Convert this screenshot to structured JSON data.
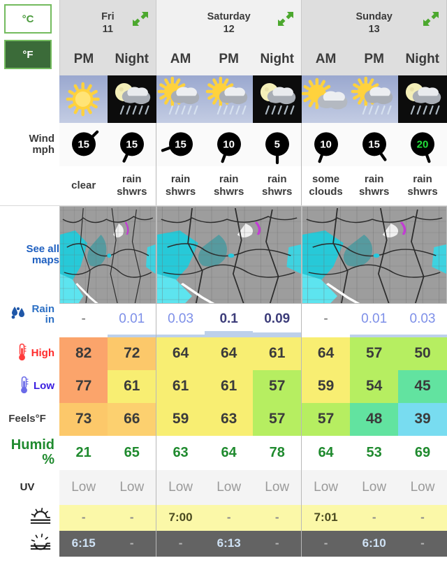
{
  "units": {
    "celsius_label": "°C",
    "fahrenheit_label": "°F",
    "selected": "°F"
  },
  "row_labels": {
    "wind": "Wind",
    "wind_unit": "mph",
    "see_all_maps_line1": "See all",
    "see_all_maps_line2": "maps",
    "rain": "Rain",
    "rain_unit": "in",
    "high": "High",
    "low": "Low",
    "feels": "Feels°F",
    "humid": "Humid",
    "humid_unit": "%",
    "uv": "UV"
  },
  "days": [
    {
      "name": "Fri",
      "date": "11",
      "slots": [
        "PM",
        "Night"
      ]
    },
    {
      "name": "Saturday",
      "date": "12",
      "slots": [
        "AM",
        "PM",
        "Night"
      ]
    },
    {
      "name": "Sunday",
      "date": "13",
      "slots": [
        "AM",
        "PM",
        "Night"
      ]
    }
  ],
  "columns": [
    {
      "day": "Fri",
      "slot": "PM",
      "night": false,
      "icon": "sun-clear-icon",
      "wind_speed": "15",
      "wind_dir_deg": 45,
      "wind_strong": false,
      "condition_line1": "clear",
      "condition_line2": "",
      "rain": "-",
      "rain_bar_pct": 0,
      "rain_emphasis": false,
      "high": "82",
      "high_color": "#fba46b",
      "low": "77",
      "low_color": "#fba46b",
      "feels": "73",
      "feels_color": "#fcc86a",
      "humid": "21",
      "uv": "Low",
      "sunrise": "-",
      "sunset": "6:15"
    },
    {
      "day": "Fri",
      "slot": "Night",
      "night": true,
      "icon": "moon-rain-icon",
      "wind_speed": "15",
      "wind_dir_deg": 205,
      "wind_strong": false,
      "condition_line1": "rain",
      "condition_line2": "shwrs",
      "rain": "0.01",
      "rain_bar_pct": 8,
      "rain_emphasis": false,
      "high": "72",
      "high_color": "#fcc86a",
      "low": "61",
      "low_color": "#f8ee72",
      "feels": "66",
      "feels_color": "#fcd06f",
      "humid": "65",
      "uv": "Low",
      "sunrise": "-",
      "sunset": "-"
    },
    {
      "day": "Saturday",
      "slot": "AM",
      "night": false,
      "icon": "sun-rain-icon",
      "wind_speed": "15",
      "wind_dir_deg": 250,
      "wind_strong": false,
      "condition_line1": "rain",
      "condition_line2": "shwrs",
      "rain": "0.03",
      "rain_bar_pct": 10,
      "rain_emphasis": false,
      "high": "64",
      "high_color": "#f8ee72",
      "low": "61",
      "low_color": "#f8ee72",
      "feels": "59",
      "feels_color": "#f8ee72",
      "humid": "63",
      "uv": "Low",
      "sunrise": "7:00",
      "sunset": "-"
    },
    {
      "day": "Saturday",
      "slot": "PM",
      "night": false,
      "icon": "sun-rain-icon",
      "wind_speed": "10",
      "wind_dir_deg": 200,
      "wind_strong": false,
      "condition_line1": "rain",
      "condition_line2": "shwrs",
      "rain": "0.1",
      "rain_bar_pct": 30,
      "rain_emphasis": true,
      "high": "64",
      "high_color": "#f8ee72",
      "low": "61",
      "low_color": "#f8ee72",
      "feels": "63",
      "feels_color": "#f8ee72",
      "humid": "64",
      "uv": "Low",
      "sunrise": "-",
      "sunset": "6:13"
    },
    {
      "day": "Saturday",
      "slot": "Night",
      "night": true,
      "icon": "moon-rain-icon",
      "wind_speed": "5",
      "wind_dir_deg": 180,
      "wind_strong": false,
      "condition_line1": "rain",
      "condition_line2": "shwrs",
      "rain": "0.09",
      "rain_bar_pct": 22,
      "rain_emphasis": true,
      "high": "61",
      "high_color": "#f8ee72",
      "low": "57",
      "low_color": "#b6ee61",
      "feels": "57",
      "feels_color": "#b6ee61",
      "humid": "78",
      "uv": "Low",
      "sunrise": "-",
      "sunset": "-"
    },
    {
      "day": "Sunday",
      "slot": "AM",
      "night": false,
      "icon": "sun-cloud-icon",
      "wind_speed": "10",
      "wind_dir_deg": 200,
      "wind_strong": false,
      "condition_line1": "some",
      "condition_line2": "clouds",
      "rain": "-",
      "rain_bar_pct": 0,
      "rain_emphasis": false,
      "high": "64",
      "high_color": "#f8ee72",
      "low": "59",
      "low_color": "#f8ee72",
      "feels": "57",
      "feels_color": "#b6ee61",
      "humid": "64",
      "uv": "Low",
      "sunrise": "7:01",
      "sunset": "-"
    },
    {
      "day": "Sunday",
      "slot": "PM",
      "night": false,
      "icon": "sun-rain-icon",
      "wind_speed": "15",
      "wind_dir_deg": 145,
      "wind_strong": false,
      "condition_line1": "rain",
      "condition_line2": "shwrs",
      "rain": "0.01",
      "rain_bar_pct": 6,
      "rain_emphasis": false,
      "high": "57",
      "high_color": "#b6ee61",
      "low": "54",
      "low_color": "#b6ee61",
      "feels": "48",
      "feels_color": "#62e3a0",
      "humid": "53",
      "uv": "Low",
      "sunrise": "-",
      "sunset": "6:10"
    },
    {
      "day": "Sunday",
      "slot": "Night",
      "night": true,
      "icon": "moon-rain-icon",
      "wind_speed": "20",
      "wind_dir_deg": 160,
      "wind_strong": true,
      "condition_line1": "rain",
      "condition_line2": "shwrs",
      "rain": "0.03",
      "rain_bar_pct": 10,
      "rain_emphasis": false,
      "high": "50",
      "high_color": "#b6ee61",
      "low": "45",
      "low_color": "#62e3a0",
      "feels": "39",
      "feels_color": "#78dcf0",
      "humid": "69",
      "uv": "Low",
      "sunrise": "-",
      "sunset": "-"
    }
  ],
  "colors": {
    "accent_blue": "#1e5fc0",
    "high_label": "#ff2b2b",
    "low_label": "#3a1ee0",
    "humid_label": "#1f8a2e",
    "rain_label": "#2b6fc4",
    "unit_selected_bg": "#3b6b39",
    "unit_border": "#73bb5e",
    "wind_strong": "#22e03a"
  }
}
